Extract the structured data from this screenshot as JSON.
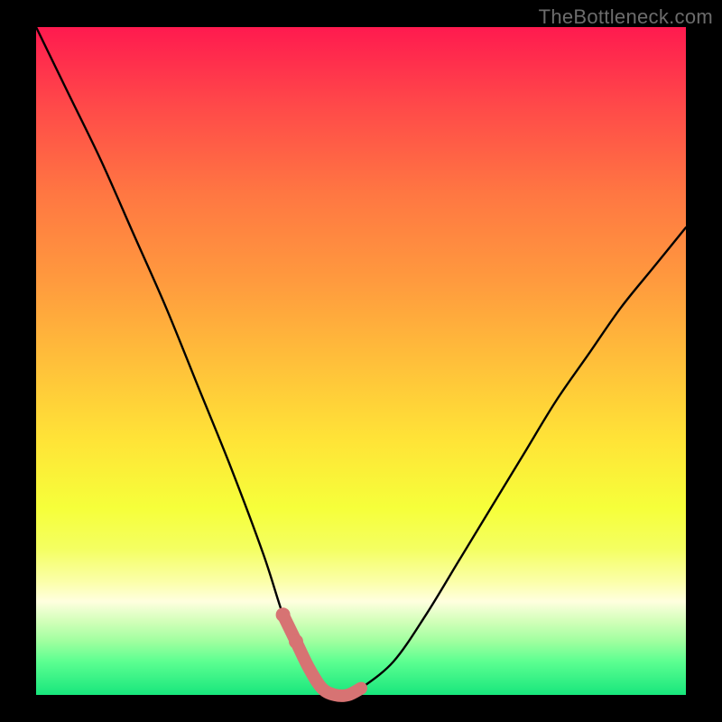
{
  "watermark": "TheBottleneck.com",
  "chart_data": {
    "type": "line",
    "title": "",
    "xlabel": "",
    "ylabel": "",
    "xlim": [
      0,
      100
    ],
    "ylim": [
      0,
      100
    ],
    "grid": false,
    "legend": false,
    "series": [
      {
        "name": "bottleneck-curve",
        "x": [
          0,
          5,
          10,
          15,
          20,
          25,
          30,
          35,
          38,
          40,
          42,
          44,
          46,
          48,
          50,
          55,
          60,
          65,
          70,
          75,
          80,
          85,
          90,
          95,
          100
        ],
        "values": [
          100,
          90,
          80,
          69,
          58,
          46,
          34,
          21,
          12,
          8,
          4,
          1,
          0,
          0,
          1,
          5,
          12,
          20,
          28,
          36,
          44,
          51,
          58,
          64,
          70
        ]
      }
    ],
    "highlight_segment": {
      "name": "trough-overlay",
      "x_start": 38,
      "x_end": 50,
      "points_x": [
        38,
        40,
        42,
        44,
        46,
        48,
        50
      ],
      "points_values": [
        12,
        8,
        4,
        1,
        0,
        0,
        1
      ]
    },
    "background_gradient": {
      "top": "#ff1a4f",
      "middle": "#ffe437",
      "bottom": "#18e67c"
    }
  }
}
